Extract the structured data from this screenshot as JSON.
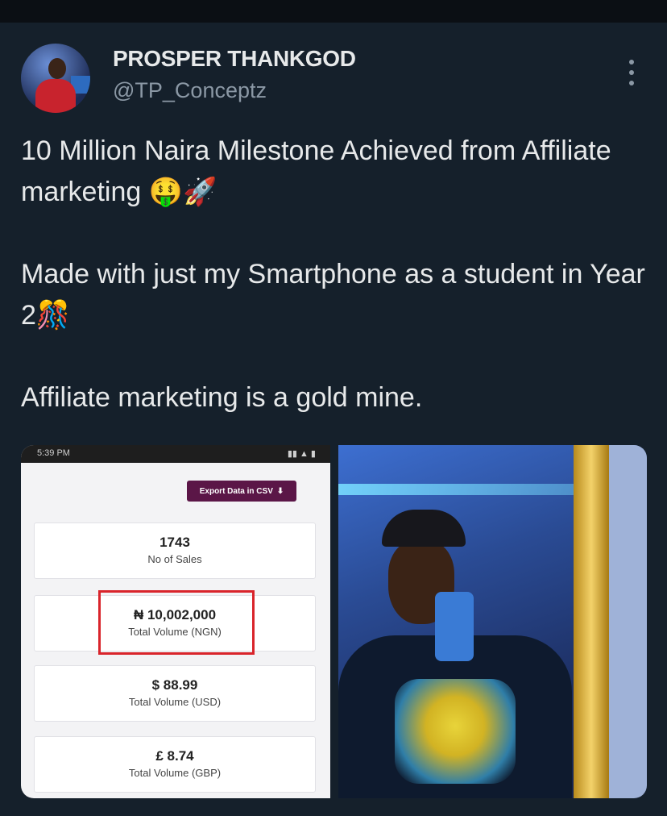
{
  "user": {
    "name": "PROSPER THANKGOD",
    "handle": "@TP_Conceptz"
  },
  "tweet": {
    "line1": "10 Million Naira Milestone Achieved from Affiliate marketing 🤑🚀",
    "line2": "Made with just my Smartphone as a student in Year 2🎊",
    "line3": "Affiliate marketing is a gold mine."
  },
  "screenshot": {
    "status_time": "5:39 PM",
    "export_label": "Export Data in CSV",
    "cards": [
      {
        "value": "1743",
        "label": "No of Sales"
      },
      {
        "value": "₦ 10,002,000",
        "label": "Total Volume (NGN)"
      },
      {
        "value": "$ 88.99",
        "label": "Total Volume (USD)"
      },
      {
        "value": "£ 8.74",
        "label": "Total Volume (GBP)"
      }
    ]
  },
  "colors": {
    "background": "#15202b",
    "text_primary": "#e7e9ea",
    "text_secondary": "#8b98a5",
    "export_button": "#5b1647",
    "highlight": "#d9242b"
  },
  "icons": [
    "more-icon",
    "download-icon"
  ]
}
